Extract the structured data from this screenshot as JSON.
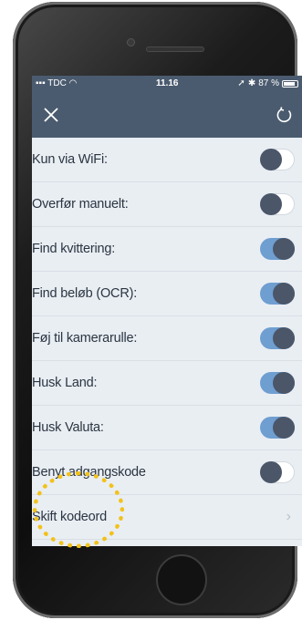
{
  "status_bar": {
    "carrier": "TDC",
    "time": "11.16",
    "battery_text": "87 %",
    "battery_level": 0.87
  },
  "nav": {
    "close_icon": "close-icon",
    "refresh_icon": "refresh-icon"
  },
  "settings": [
    {
      "label": "Kun via WiFi:",
      "state": "off"
    },
    {
      "label": "Overfør manuelt:",
      "state": "off"
    },
    {
      "label": "Find kvittering:",
      "state": "on"
    },
    {
      "label": "Find beløb (OCR):",
      "state": "on"
    },
    {
      "label": "Føj til kamerarulle:",
      "state": "on"
    },
    {
      "label": "Husk Land:",
      "state": "on"
    },
    {
      "label": "Husk Valuta:",
      "state": "on"
    },
    {
      "label": "Benyt adgangskode",
      "state": "off"
    }
  ],
  "change_password": {
    "label": "Skift kodeord"
  },
  "colors": {
    "header": "#4b5b6f",
    "toggle_on": "#6f9ed1",
    "knob": "#4b5669",
    "highlight": "#f2c21b"
  }
}
